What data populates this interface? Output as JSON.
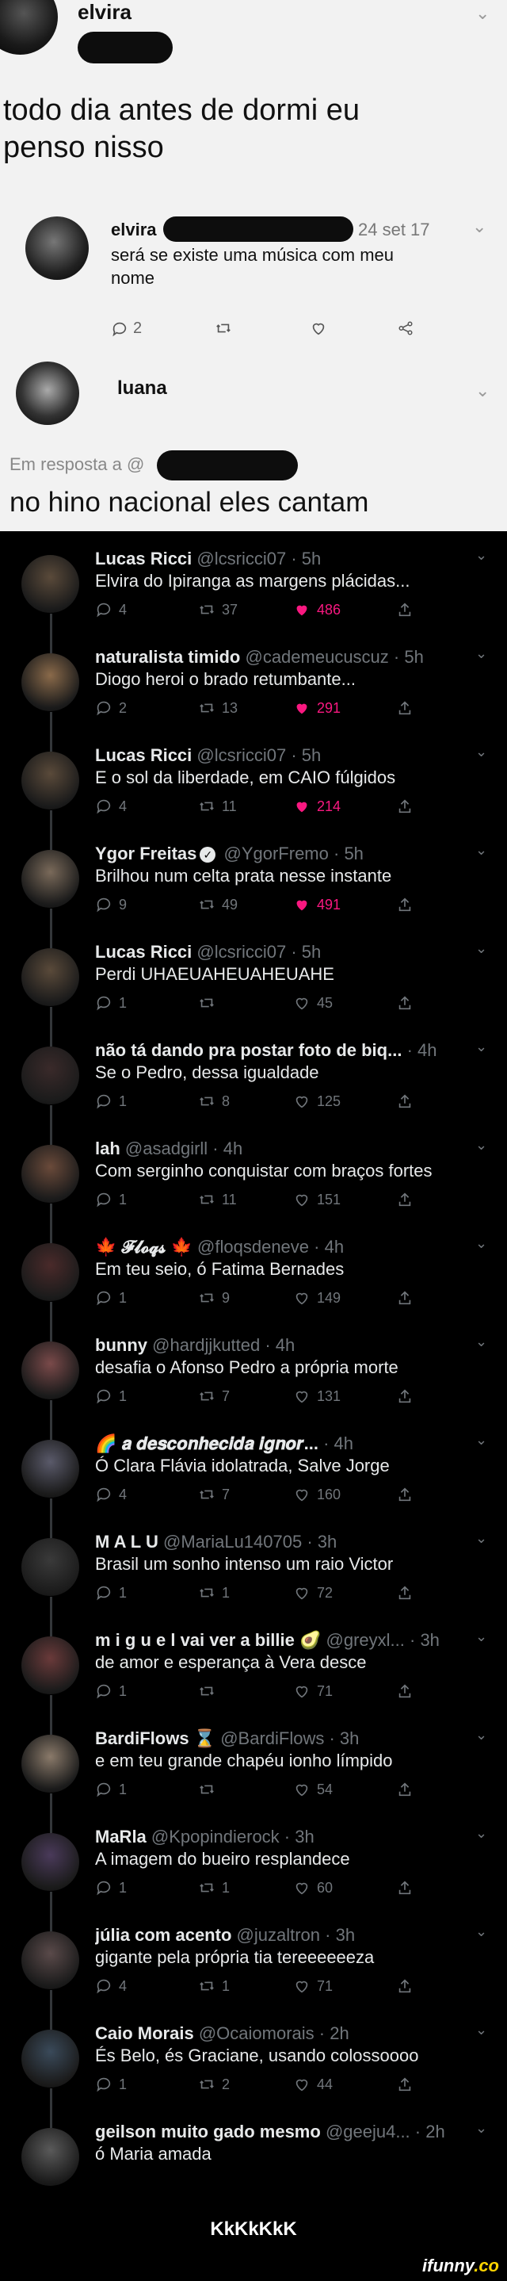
{
  "original_post": {
    "author_name": "elvira",
    "text_line1": "todo dia antes de dormi eu",
    "text_line2": "penso nisso"
  },
  "quoted_post": {
    "author_name": "elvira",
    "date": "24 set 17",
    "text_line1": "será se existe uma música com meu",
    "text_line2": "nome",
    "reply_count": "2"
  },
  "reply_post": {
    "author_name": "luana",
    "in_reply_to_label": "Em resposta a @",
    "text": "no hino nacional eles cantam"
  },
  "thread": [
    {
      "name": "Lucas Ricci",
      "handle": "@lcsricci07",
      "time": "5h",
      "text": "Elvira do Ipiranga as margens plácidas...",
      "replies": "4",
      "retweets": "37",
      "likes": "486",
      "liked": true,
      "avatar_color": "#5a4a3a"
    },
    {
      "name": "naturalista timido",
      "handle": "@cademeucuscuz",
      "time": "5h",
      "text": "Diogo heroi o brado retumbante...",
      "replies": "2",
      "retweets": "13",
      "likes": "291",
      "liked": true,
      "avatar_color": "#8a6a4a"
    },
    {
      "name": "Lucas Ricci",
      "handle": "@lcsricci07",
      "time": "5h",
      "text": "E o sol da liberdade, em CAIO fúlgidos",
      "replies": "4",
      "retweets": "11",
      "likes": "214",
      "liked": true,
      "avatar_color": "#5a4a3a"
    },
    {
      "name": "Ygor Freitas",
      "handle": "@YgorFremo",
      "time": "5h",
      "text": "Brilhou num celta prata nesse instante",
      "replies": "9",
      "retweets": "49",
      "likes": "491",
      "liked": true,
      "verified": true,
      "avatar_color": "#7a6a5a"
    },
    {
      "name": "Lucas Ricci",
      "handle": "@lcsricci07",
      "time": "5h",
      "text": "Perdi UHAEUAHEUAHEUAHE",
      "replies": "1",
      "retweets": "",
      "likes": "45",
      "liked": false,
      "avatar_color": "#5a4a3a"
    },
    {
      "name": "não tá dando pra postar foto de biq...",
      "handle": "",
      "time": "4h",
      "text": "Se o Pedro, dessa igualdade",
      "replies": "1",
      "retweets": "8",
      "likes": "125",
      "liked": false,
      "avatar_color": "#3a2a2a"
    },
    {
      "name": "lah",
      "handle": "@asadgirll",
      "time": "4h",
      "text": "Com serginho conquistar com braços fortes",
      "replies": "1",
      "retweets": "11",
      "likes": "151",
      "liked": false,
      "avatar_color": "#6a4a3a"
    },
    {
      "name": "🍁 𝓕𝓵𝓸𝓺𝓼 🍁",
      "handle": "@floqsdeneve",
      "time": "4h",
      "text": "Em teu seio, ó Fatima Bernades",
      "replies": "1",
      "retweets": "9",
      "likes": "149",
      "liked": false,
      "avatar_color": "#4a2a2a"
    },
    {
      "name": "bunny",
      "handle": "@hardjjkutted",
      "time": "4h",
      "text": "desafia o Afonso Pedro a própria morte",
      "replies": "1",
      "retweets": "7",
      "likes": "131",
      "liked": false,
      "avatar_color": "#7a4a4a"
    },
    {
      "name": "🌈 𝒂 𝒅𝒆𝒔𝒄𝒐𝒏𝒉𝒆𝒄𝒊𝒅𝒂 𝒊𝒈𝒏𝒐𝒓...",
      "handle": "",
      "time": "4h",
      "text": "Ó Clara Flávia idolatrada, Salve Jorge",
      "replies": "4",
      "retweets": "7",
      "likes": "160",
      "liked": false,
      "avatar_color": "#5a5a6a"
    },
    {
      "name": "M A L U",
      "handle": "@MariaLu140705",
      "time": "3h",
      "text": "Brasil um sonho intenso um raio Victor",
      "replies": "1",
      "retweets": "1",
      "likes": "72",
      "liked": false,
      "avatar_color": "#3a3a3a"
    },
    {
      "name": "m i g u e l vai ver a billie 🥑",
      "handle": "@greyxl...",
      "time": "3h",
      "text": "de amor e esperança à Vera desce",
      "replies": "1",
      "retweets": "",
      "likes": "71",
      "liked": false,
      "avatar_color": "#6a3a3a"
    },
    {
      "name": "BardiFlows ⌛",
      "handle": "@BardiFlows",
      "time": "3h",
      "text": "e em teu grande chapéu ionho límpido",
      "replies": "1",
      "retweets": "",
      "likes": "54",
      "liked": false,
      "avatar_color": "#8a7a6a"
    },
    {
      "name": "MaRla",
      "handle": "@Kpopindierock",
      "time": "3h",
      "text": "A imagem do bueiro resplandece",
      "replies": "1",
      "retweets": "1",
      "likes": "60",
      "liked": false,
      "avatar_color": "#4a3a5a"
    },
    {
      "name": "júlia com acento",
      "handle": "@juzaltron",
      "time": "3h",
      "text": "gigante pela própria tia tereeeeeeza",
      "replies": "4",
      "retweets": "1",
      "likes": "71",
      "liked": false,
      "avatar_color": "#5a4a4a"
    },
    {
      "name": "Caio Morais",
      "handle": "@Ocaiomorais",
      "time": "2h",
      "text": "És Belo, és Graciane, usando colossoooo",
      "replies": "1",
      "retweets": "2",
      "likes": "44",
      "liked": false,
      "avatar_color": "#3a4a5a"
    },
    {
      "name": "geilson muito gado mesmo",
      "handle": "@geeju4...",
      "time": "2h",
      "text": "ó Maria amada",
      "replies": "",
      "retweets": "",
      "likes": "",
      "liked": false,
      "partial": true,
      "avatar_color": "#5a5a5a"
    }
  ],
  "caption": "KkKkKkK",
  "watermark": {
    "brand": "ifunny",
    "tld": ".co"
  },
  "colors": {
    "like_pink": "#f91880",
    "muted_grey": "#71767b",
    "light_bg": "#f2f2f2"
  }
}
